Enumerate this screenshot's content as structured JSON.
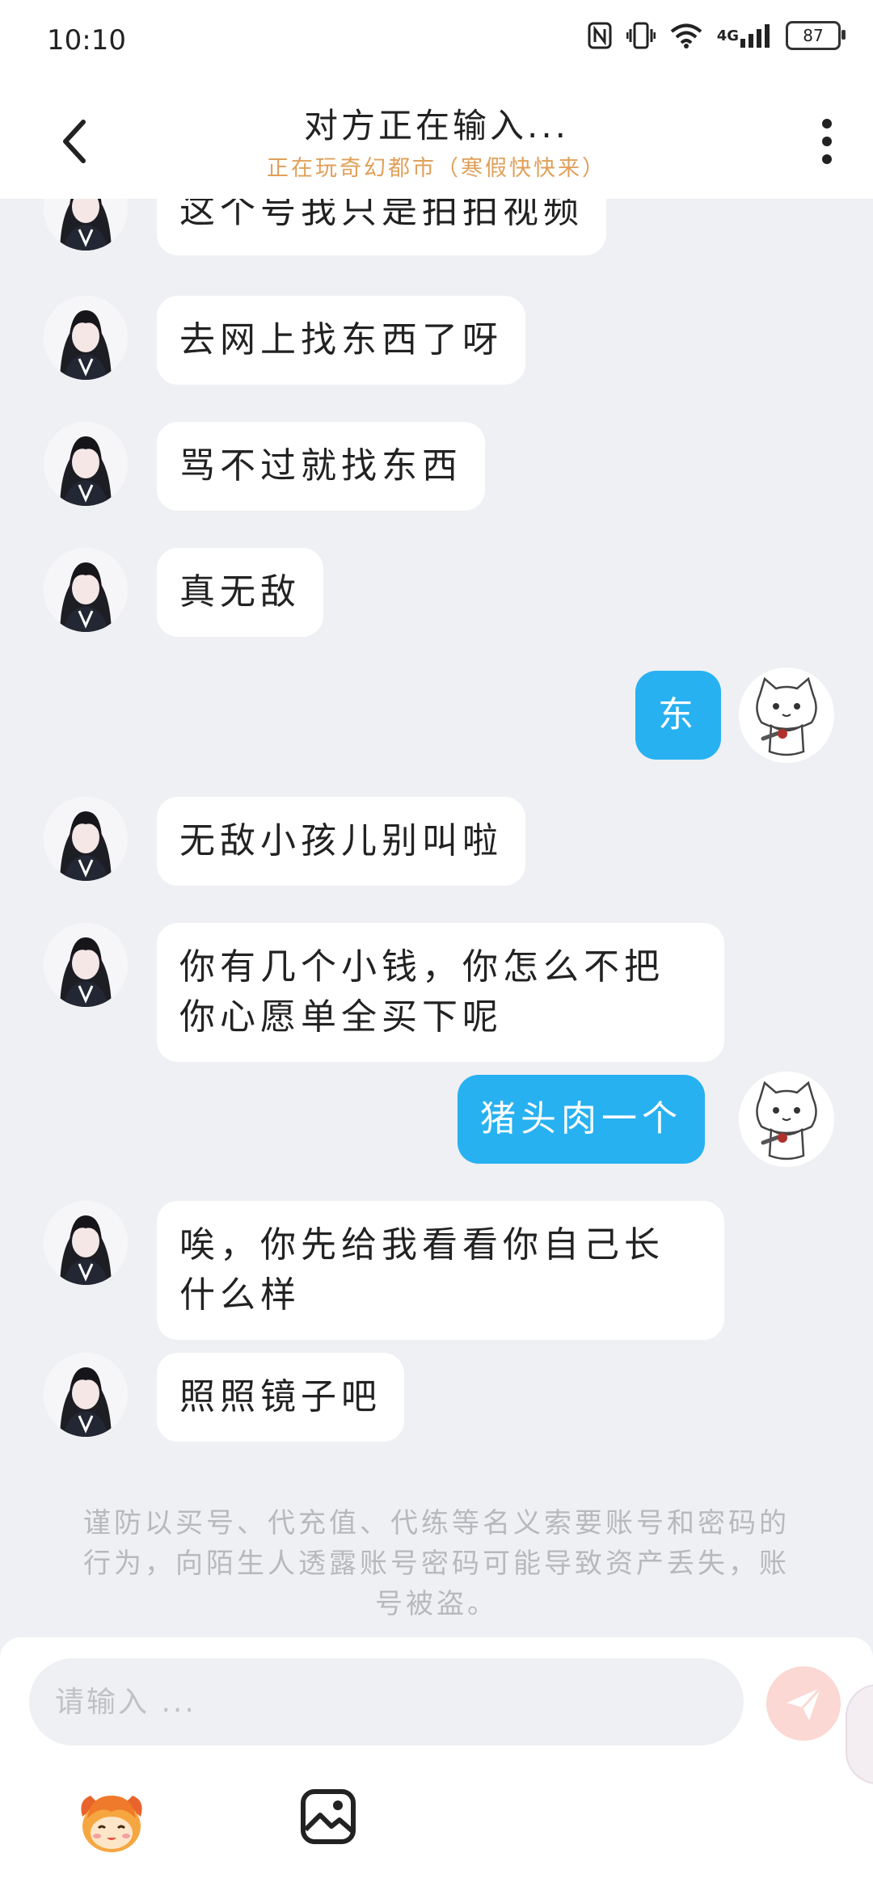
{
  "status_bar": {
    "time": "10:10",
    "network": "4G",
    "battery": "87",
    "icons": [
      "nfc-icon",
      "vibrate-icon",
      "wifi-icon",
      "signal-icon",
      "battery-icon"
    ]
  },
  "header": {
    "title": "对方正在输入...",
    "subtitle": "正在玩奇幻都市（寒假快快来）",
    "subtitle_color": "#e0a05a",
    "back_icon": "back-arrow-icon",
    "menu_icon": "more-vertical-icon"
  },
  "messages": [
    {
      "side": "left",
      "text": "这个号我只是拍拍视频"
    },
    {
      "side": "left",
      "text": "去网上找东西了呀"
    },
    {
      "side": "left",
      "text": "骂不过就找东西"
    },
    {
      "side": "left",
      "text": "真无敌"
    },
    {
      "side": "right",
      "text": "东"
    },
    {
      "side": "left",
      "text": "无敌小孩儿别叫啦"
    },
    {
      "side": "left",
      "text": "你有几个小钱，你怎么不把你心愿单全买下呢"
    },
    {
      "side": "right",
      "text": "猪头肉一个"
    },
    {
      "side": "left",
      "text": "唉，你先给我看看你自己长什么样"
    },
    {
      "side": "left",
      "text": "照照镜子吧"
    }
  ],
  "notice": "谨防以买号、代充值、代练等名义索要账号和密码的行为，向陌生人透露账号密码可能导致资产丢失，账号被盗。",
  "composer": {
    "placeholder": "请输入 ...",
    "send_icon": "send-icon",
    "emoji_icon": "emoji-sticker-icon",
    "image_icon": "image-icon"
  },
  "colors": {
    "accent": "#28b1f1",
    "background": "#eef0f4",
    "send_button": "#fbd8d3"
  }
}
